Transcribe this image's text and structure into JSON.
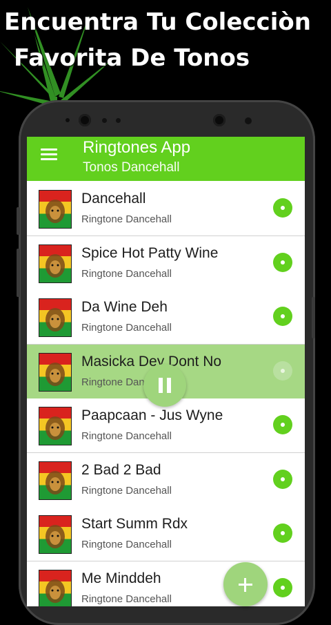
{
  "promo": {
    "line1": "Encuentra Tu Colecciòn",
    "line2": "Favorita De Tonos"
  },
  "app": {
    "title": "Ringtones App",
    "subtitle": "Tonos Dancehall"
  },
  "colors": {
    "accent": "#62d01e",
    "active_row": "#a6d884",
    "fab": "#9fd57c"
  },
  "icons": {
    "menu": "hamburger-menu-icon",
    "play": "play-icon",
    "pause": "pause-icon",
    "add": "plus-icon",
    "thumb": "lion-rasta-thumbnail"
  },
  "list": [
    {
      "title": "Dancehall",
      "subtitle": "Ringtone Dancehall"
    },
    {
      "title": "Spice Hot Patty Wine",
      "subtitle": "Ringtone Dancehall"
    },
    {
      "title": "Da Wine Deh",
      "subtitle": "Ringtone Dancehall"
    },
    {
      "title": "Masicka Dey Dont No",
      "subtitle": "Ringtone Dancehall",
      "playing": true
    },
    {
      "title": "Paapcaan - Jus Wyne",
      "subtitle": "Ringtone Dancehall"
    },
    {
      "title": "2 Bad 2 Bad",
      "subtitle": "Ringtone Dancehall"
    },
    {
      "title": "Start Summ Rdx",
      "subtitle": "Ringtone Dancehall"
    },
    {
      "title": "Me Minddeh",
      "subtitle": "Ringtone Dancehall"
    }
  ]
}
